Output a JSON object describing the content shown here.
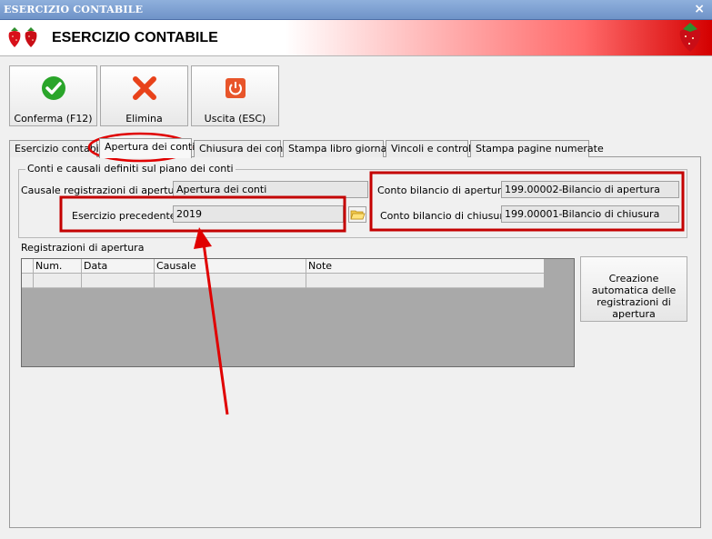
{
  "window": {
    "title": "ESERCIZIO CONTABILE",
    "close_glyph": "×"
  },
  "header": {
    "title": "ESERCIZIO CONTABILE"
  },
  "toolbar": {
    "confirm_label": "Conferma (F12)",
    "delete_label": "Elimina",
    "exit_label": "Uscita (ESC)"
  },
  "tabs": [
    {
      "label": "Esercizio contabile"
    },
    {
      "label": "Apertura dei conti"
    },
    {
      "label": "Chiusura dei conti"
    },
    {
      "label": "Stampa libro giornale"
    },
    {
      "label": "Vincoli e controlli"
    },
    {
      "label": "Stampa pagine numerate"
    }
  ],
  "group": {
    "legend": "Conti e causali definiti sul piano dei conti",
    "causale_label": "Causale registrazioni di apertura :",
    "causale_value": "Apertura dei conti",
    "esercizio_label": "Esercizio precedente :",
    "esercizio_value": "2019",
    "conto_apertura_label": "Conto bilancio di apertura :",
    "conto_apertura_value": "199.00002-Bilancio di apertura",
    "conto_chiusura_label": "Conto bilancio di chiusura :",
    "conto_chiusura_value": "199.00001-Bilancio di chiusura"
  },
  "registrazioni": {
    "title": "Registrazioni di apertura",
    "columns": [
      "Num.",
      "Data",
      "Causale",
      "Note"
    ]
  },
  "auto_button": {
    "label": "Creazione automatica delle registrazioni di apertura"
  },
  "colors": {
    "annotation": "#e00000"
  }
}
